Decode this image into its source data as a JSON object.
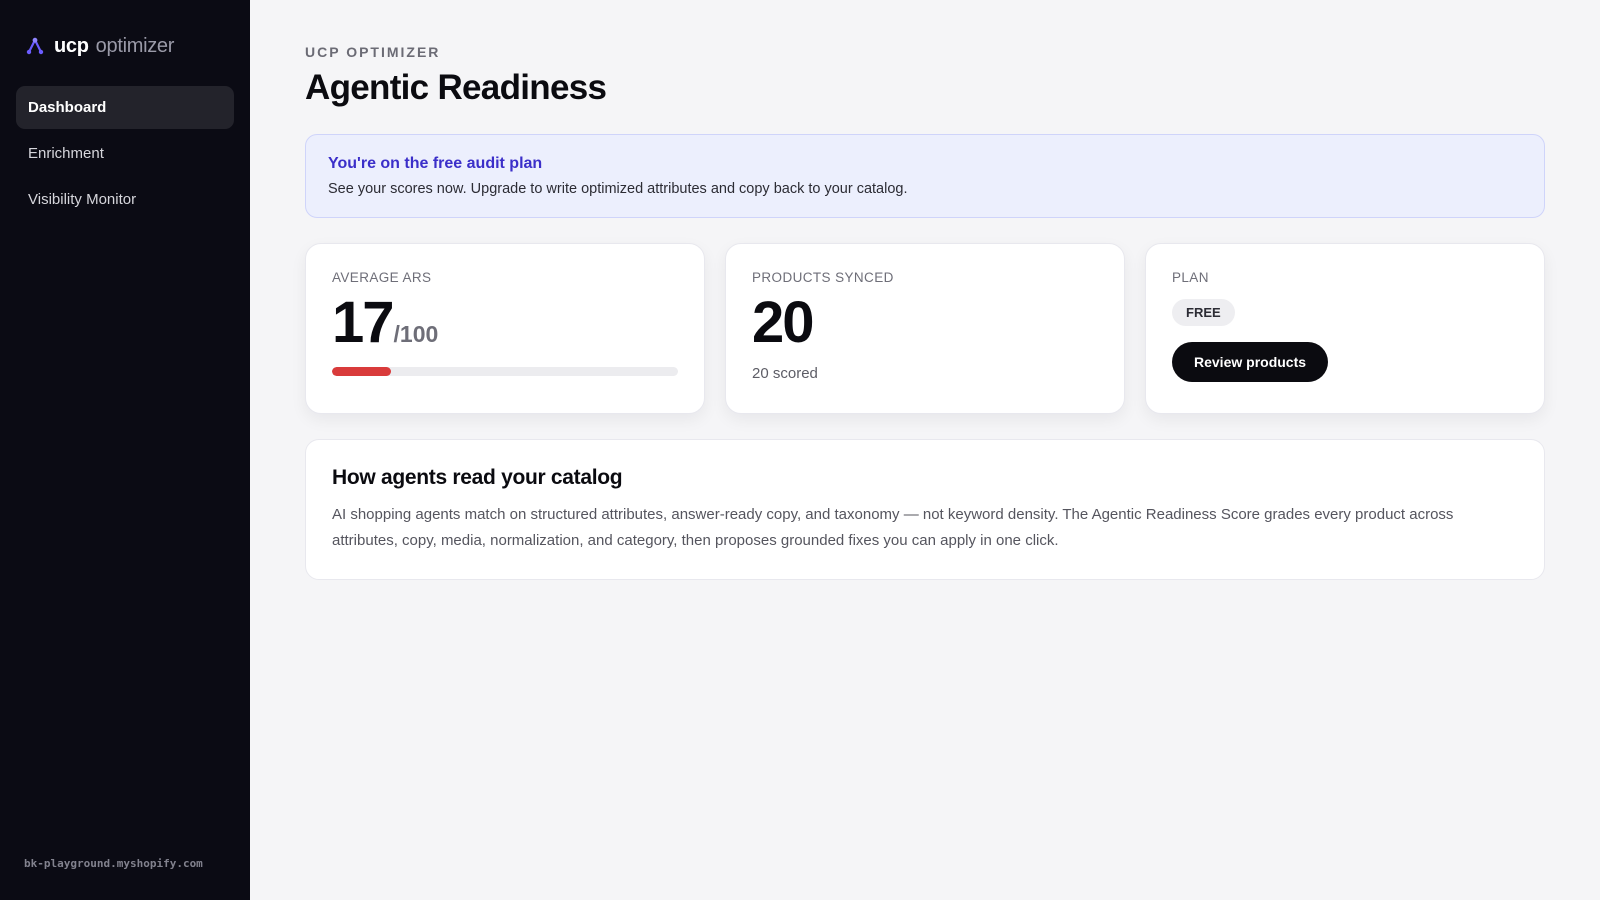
{
  "sidebar": {
    "brand_strong": "ucp",
    "brand_light": "optimizer",
    "items": [
      {
        "label": "Dashboard"
      },
      {
        "label": "Enrichment"
      },
      {
        "label": "Visibility Monitor"
      }
    ],
    "store_domain": "bk-playground.myshopify.com"
  },
  "header": {
    "eyebrow": "UCP OPTIMIZER",
    "title": "Agentic Readiness"
  },
  "notice": {
    "title": "You're on the free audit plan",
    "text": "See your scores now. Upgrade to write optimized attributes and copy back to your catalog."
  },
  "cards": {
    "ars": {
      "label": "AVERAGE ARS",
      "value": "17",
      "suffix": "/100",
      "progress_fraction": 0.17,
      "bar_color": "#d93b3b"
    },
    "synced": {
      "label": "PRODUCTS SYNCED",
      "value": "20",
      "sub": "20 scored"
    },
    "plan": {
      "label": "PLAN",
      "badge": "FREE",
      "button": "Review products"
    }
  },
  "info": {
    "title": "How agents read your catalog",
    "text": "AI shopping agents match on structured attributes, answer-ready copy, and taxonomy — not keyword density. The Agentic Readiness Score grades every product across attributes, copy, media, normalization, and category, then proposes grounded fixes you can apply in one click."
  },
  "colors": {
    "accent": "#3b2fc9",
    "sidebar_bg": "#0b0b14",
    "logo": "#6b5cff"
  },
  "icons": {
    "logo": "tripod-logo-icon"
  }
}
